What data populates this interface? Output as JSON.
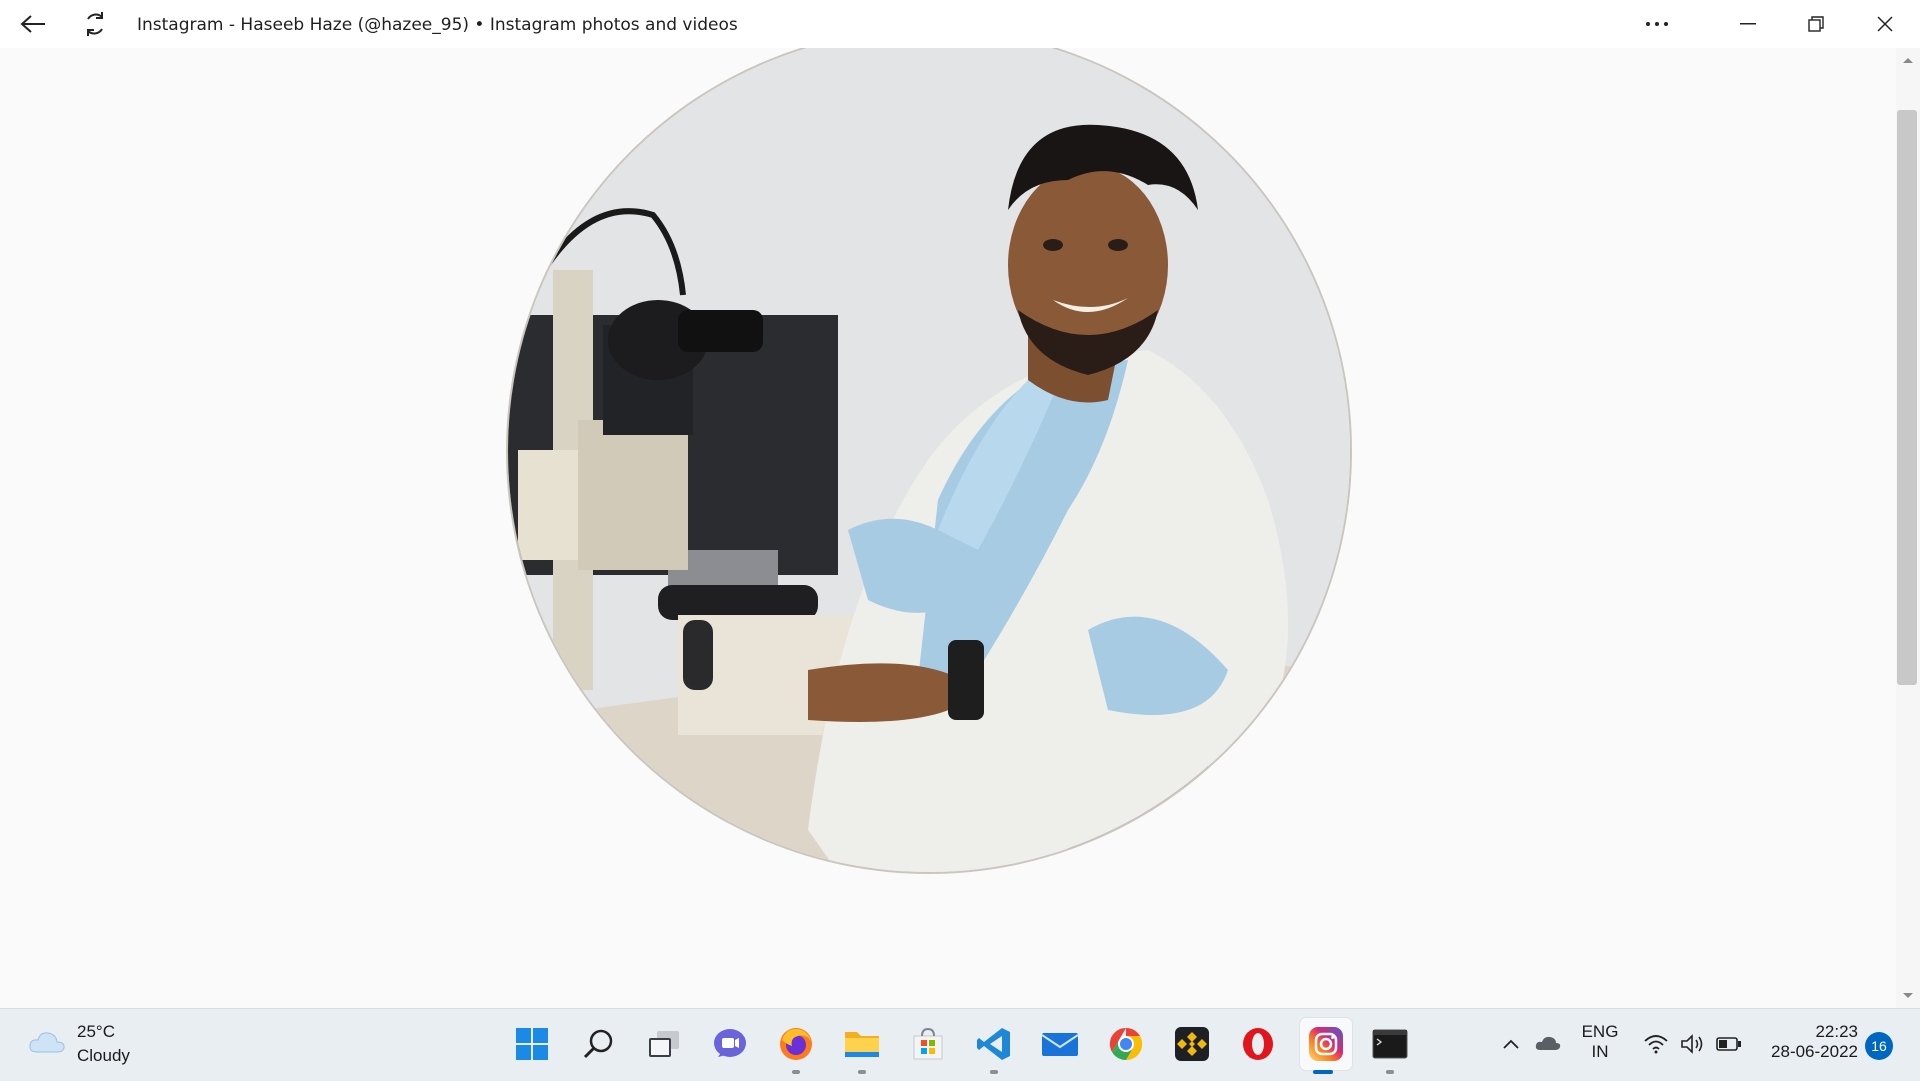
{
  "window": {
    "title": "Instagram - Haseeb Haze (@hazee_95) • Instagram photos and videos"
  },
  "profile": {
    "image_alt": "Profile photo"
  },
  "taskbar": {
    "weather": {
      "temp": "25°C",
      "desc": "Cloudy"
    },
    "apps": [
      "Start",
      "Search",
      "Task View",
      "Teams",
      "Firefox",
      "File Explorer",
      "Microsoft Store",
      "VS Code",
      "Mail",
      "Chrome",
      "Binance",
      "Opera",
      "Instagram",
      "Terminal"
    ],
    "language": {
      "line1": "ENG",
      "line2": "IN"
    },
    "clock": {
      "time": "22:23",
      "date": "28-06-2022"
    },
    "notifications": "16"
  }
}
